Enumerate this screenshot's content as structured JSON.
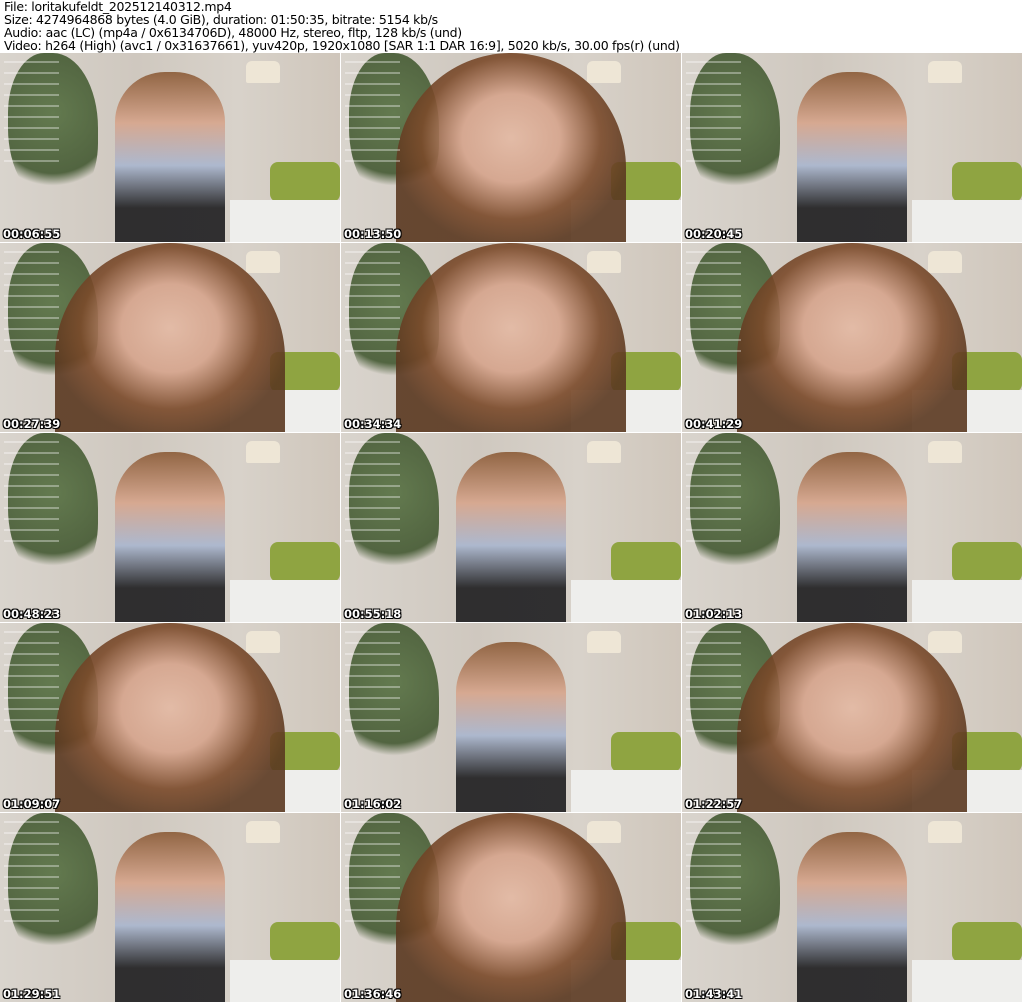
{
  "header": {
    "file": "File: loritakufeldt_202512140312.mp4",
    "size": "Size: 4274964868 bytes (4.0 GiB), duration: 01:50:35, bitrate: 5154 kb/s",
    "audio": "Audio: aac (LC) (mp4a / 0x6134706D), 48000 Hz, stereo, fltp, 128 kb/s (und)",
    "video": "Video: h264 (High) (avc1 / 0x31637661), yuv420p, 1920x1080 [SAR 1:1 DAR 16:9], 5020 kb/s, 30.00 fps(r) (und)"
  },
  "thumbnails": [
    {
      "timestamp": "00:06:55",
      "shot": "full"
    },
    {
      "timestamp": "00:13:50",
      "shot": "close"
    },
    {
      "timestamp": "00:20:45",
      "shot": "full"
    },
    {
      "timestamp": "00:27:39",
      "shot": "close"
    },
    {
      "timestamp": "00:34:34",
      "shot": "close"
    },
    {
      "timestamp": "00:41:29",
      "shot": "close"
    },
    {
      "timestamp": "00:48:23",
      "shot": "full"
    },
    {
      "timestamp": "00:55:18",
      "shot": "full"
    },
    {
      "timestamp": "01:02:13",
      "shot": "full"
    },
    {
      "timestamp": "01:09:07",
      "shot": "close"
    },
    {
      "timestamp": "01:16:02",
      "shot": "full"
    },
    {
      "timestamp": "01:22:57",
      "shot": "close"
    },
    {
      "timestamp": "01:29:51",
      "shot": "full"
    },
    {
      "timestamp": "01:36:46",
      "shot": "close"
    },
    {
      "timestamp": "01:43:41",
      "shot": "full"
    }
  ]
}
